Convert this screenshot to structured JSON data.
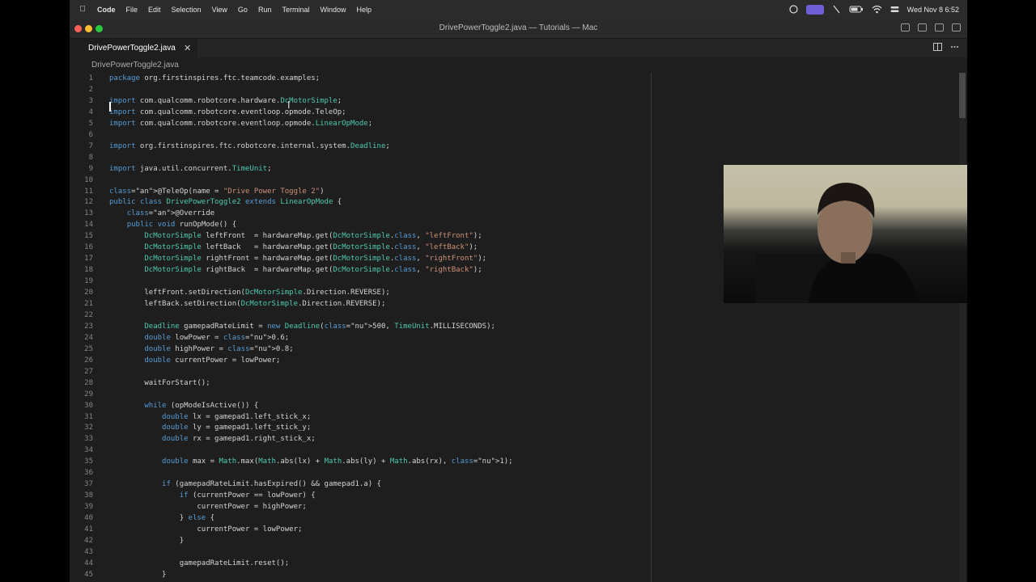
{
  "menubar": {
    "apple_icon": "apple-logo-icon",
    "items": [
      "Code",
      "File",
      "Edit",
      "Selection",
      "View",
      "Go",
      "Run",
      "Terminal",
      "Window",
      "Help"
    ],
    "clock": "Wed Nov 8  6:52"
  },
  "window": {
    "title": "DrivePowerToggle2.java — Tutorials — Mac"
  },
  "tab": {
    "label": "DrivePowerToggle2.java",
    "close_glyph": "✕"
  },
  "breadcrumb": "DrivePowerToggle2.java",
  "lines": [
    {
      "n": "1",
      "t": "package org.firstinspires.ftc.teamcode.examples;"
    },
    {
      "n": "2",
      "t": ""
    },
    {
      "n": "3",
      "t": "import com.qualcomm.robotcore.hardware.DcMotorSimple;"
    },
    {
      "n": "4",
      "t": "import com.qualcomm.robotcore.eventloop.opmode.TeleOp;"
    },
    {
      "n": "5",
      "t": "import com.qualcomm.robotcore.eventloop.opmode.LinearOpMode;"
    },
    {
      "n": "6",
      "t": ""
    },
    {
      "n": "7",
      "t": "import org.firstinspires.ftc.robotcore.internal.system.Deadline;"
    },
    {
      "n": "8",
      "t": ""
    },
    {
      "n": "9",
      "t": "import java.util.concurrent.TimeUnit;"
    },
    {
      "n": "10",
      "t": ""
    },
    {
      "n": "11",
      "t": "@TeleOp(name = \"Drive Power Toggle 2\")"
    },
    {
      "n": "12",
      "t": "public class DrivePowerToggle2 extends LinearOpMode {"
    },
    {
      "n": "13",
      "t": "    @Override"
    },
    {
      "n": "14",
      "t": "    public void runOpMode() {"
    },
    {
      "n": "15",
      "t": "        DcMotorSimple leftFront  = hardwareMap.get(DcMotorSimple.class, \"leftFront\");"
    },
    {
      "n": "16",
      "t": "        DcMotorSimple leftBack   = hardwareMap.get(DcMotorSimple.class, \"leftBack\");"
    },
    {
      "n": "17",
      "t": "        DcMotorSimple rightFront = hardwareMap.get(DcMotorSimple.class, \"rightFront\");"
    },
    {
      "n": "18",
      "t": "        DcMotorSimple rightBack  = hardwareMap.get(DcMotorSimple.class, \"rightBack\");"
    },
    {
      "n": "19",
      "t": ""
    },
    {
      "n": "20",
      "t": "        leftFront.setDirection(DcMotorSimple.Direction.REVERSE);"
    },
    {
      "n": "21",
      "t": "        leftBack.setDirection(DcMotorSimple.Direction.REVERSE);"
    },
    {
      "n": "22",
      "t": ""
    },
    {
      "n": "23",
      "t": "        Deadline gamepadRateLimit = new Deadline(500, TimeUnit.MILLISECONDS);"
    },
    {
      "n": "24",
      "t": "        double lowPower = 0.6;"
    },
    {
      "n": "25",
      "t": "        double highPower = 0.8;"
    },
    {
      "n": "26",
      "t": "        double currentPower = lowPower;"
    },
    {
      "n": "27",
      "t": ""
    },
    {
      "n": "28",
      "t": "        waitForStart();"
    },
    {
      "n": "29",
      "t": ""
    },
    {
      "n": "30",
      "t": "        while (opModeIsActive()) {"
    },
    {
      "n": "31",
      "t": "            double lx = gamepad1.left_stick_x;"
    },
    {
      "n": "32",
      "t": "            double ly = gamepad1.left_stick_y;"
    },
    {
      "n": "33",
      "t": "            double rx = gamepad1.right_stick_x;"
    },
    {
      "n": "34",
      "t": ""
    },
    {
      "n": "35",
      "t": "            double max = Math.max(Math.abs(lx) + Math.abs(ly) + Math.abs(rx), 1);"
    },
    {
      "n": "36",
      "t": ""
    },
    {
      "n": "37",
      "t": "            if (gamepadRateLimit.hasExpired() && gamepad1.a) {"
    },
    {
      "n": "38",
      "t": "                if (currentPower == lowPower) {"
    },
    {
      "n": "39",
      "t": "                    currentPower = highPower;"
    },
    {
      "n": "40",
      "t": "                } else {"
    },
    {
      "n": "41",
      "t": "                    currentPower = lowPower;"
    },
    {
      "n": "42",
      "t": "                }"
    },
    {
      "n": "43",
      "t": ""
    },
    {
      "n": "44",
      "t": "                gamepadRateLimit.reset();"
    },
    {
      "n": "45",
      "t": "            }"
    }
  ]
}
